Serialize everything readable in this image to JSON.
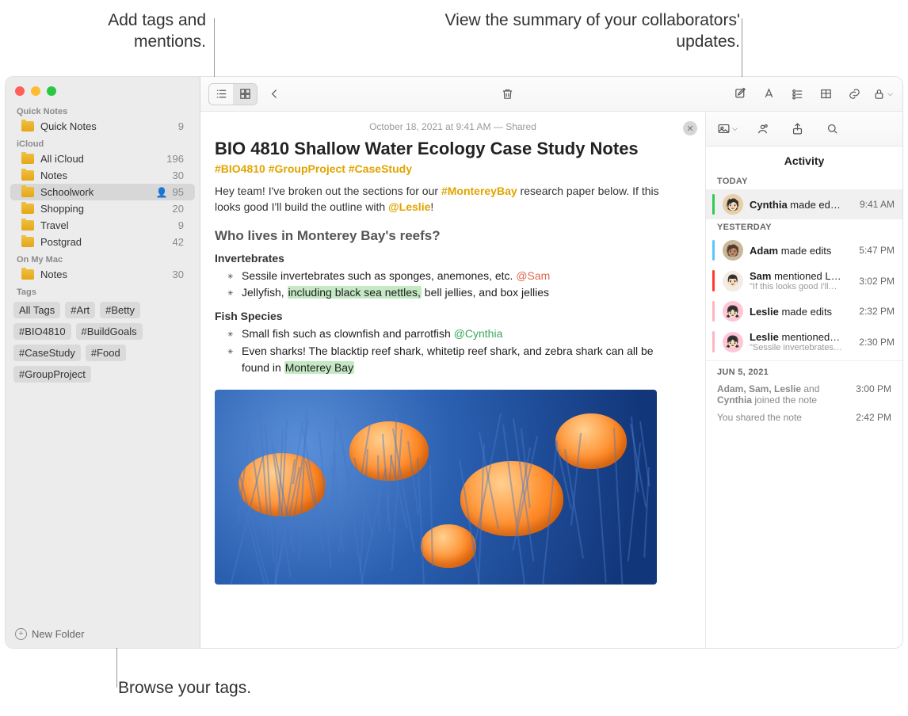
{
  "callouts": {
    "tags_mentions": "Add tags and mentions.",
    "activity_summary": "View the summary of your collaborators' updates.",
    "browse_tags": "Browse your tags."
  },
  "sidebar": {
    "sections": {
      "quick_notes_label": "Quick Notes",
      "icloud_label": "iCloud",
      "on_my_mac_label": "On My Mac",
      "tags_label": "Tags"
    },
    "quick_notes": {
      "label": "Quick Notes",
      "count": "9"
    },
    "icloud": [
      {
        "label": "All iCloud",
        "count": "196"
      },
      {
        "label": "Notes",
        "count": "30"
      },
      {
        "label": "Schoolwork",
        "count": "95",
        "shared": true,
        "selected": true
      },
      {
        "label": "Shopping",
        "count": "20"
      },
      {
        "label": "Travel",
        "count": "9"
      },
      {
        "label": "Postgrad",
        "count": "42"
      }
    ],
    "on_my_mac": [
      {
        "label": "Notes",
        "count": "30"
      }
    ],
    "tags": [
      "All Tags",
      "#Art",
      "#Betty",
      "#BIO4810",
      "#BuildGoals",
      "#CaseStudy",
      "#Food",
      "#GroupProject"
    ],
    "new_folder_label": "New Folder"
  },
  "note": {
    "meta": "October 18, 2021 at 9:41 AM — Shared",
    "title": "BIO 4810 Shallow Water Ecology Case Study Notes",
    "tags_line": "#BIO4810 #GroupProject #CaseStudy",
    "intro_pre": "Hey team! I've broken out the sections for our ",
    "intro_hashtag": "#MontereyBay",
    "intro_mid": " research paper below. If this looks good I'll build the outline with ",
    "intro_mention": "@Leslie",
    "intro_post": "!",
    "h2": "Who lives in Monterey Bay's reefs?",
    "invertebrates_heading": "Invertebrates",
    "inv1_pre": "Sessile invertebrates such as sponges, anemones, etc. ",
    "inv1_mention": "@Sam",
    "inv2_pre": "Jellyfish, ",
    "inv2_hl": "including black sea nettles,",
    "inv2_post": " bell jellies, and box jellies",
    "fish_heading": "Fish Species",
    "fish1_pre": "Small fish such as clownfish and parrotfish ",
    "fish1_mention": "@Cynthia",
    "fish2_pre": "Even sharks! The blacktip reef shark, whitetip reef shark, and zebra shark can all be found in ",
    "fish2_hl": "Monterey Bay"
  },
  "activity": {
    "title": "Activity",
    "today_label": "TODAY",
    "yesterday_label": "YESTERDAY",
    "older_label": "JUN 5, 2021",
    "today": [
      {
        "name": "Cynthia",
        "verb": " made ed…",
        "time": "9:41 AM",
        "bar": "#34c759"
      }
    ],
    "yesterday": [
      {
        "name": "Adam",
        "verb": " made edits",
        "time": "5:47 PM",
        "bar": "#5ac8fa",
        "sub": ""
      },
      {
        "name": "Sam",
        "verb": " mentioned L…",
        "time": "3:02 PM",
        "bar": "#ff3b30",
        "sub": "\"If this looks good I'll…"
      },
      {
        "name": "Leslie",
        "verb": " made edits",
        "time": "2:32 PM",
        "bar": "#ffb6c1",
        "sub": ""
      },
      {
        "name": "Leslie",
        "verb": " mentioned…",
        "time": "2:30 PM",
        "bar": "#ffb6c1",
        "sub": "\"Sessile invertebrates…"
      }
    ],
    "older": [
      {
        "text_strong": "Adam, Sam, Leslie",
        "text_mid": " and ",
        "text_strong2": "Cynthia",
        "text_rest": " joined the note",
        "time": "3:00 PM"
      },
      {
        "text_plain": "You shared the note",
        "time": "2:42 PM"
      }
    ]
  },
  "avatars": {
    "cynthia": {
      "bg": "#e8cfa8",
      "emoji": "🧑🏻"
    },
    "adam": {
      "bg": "#c9b89a",
      "emoji": "🧑🏽"
    },
    "sam": {
      "bg": "#f2ece4",
      "emoji": "👨🏻"
    },
    "leslie": {
      "bg": "#ffc6d8",
      "emoji": "👧🏻"
    }
  }
}
